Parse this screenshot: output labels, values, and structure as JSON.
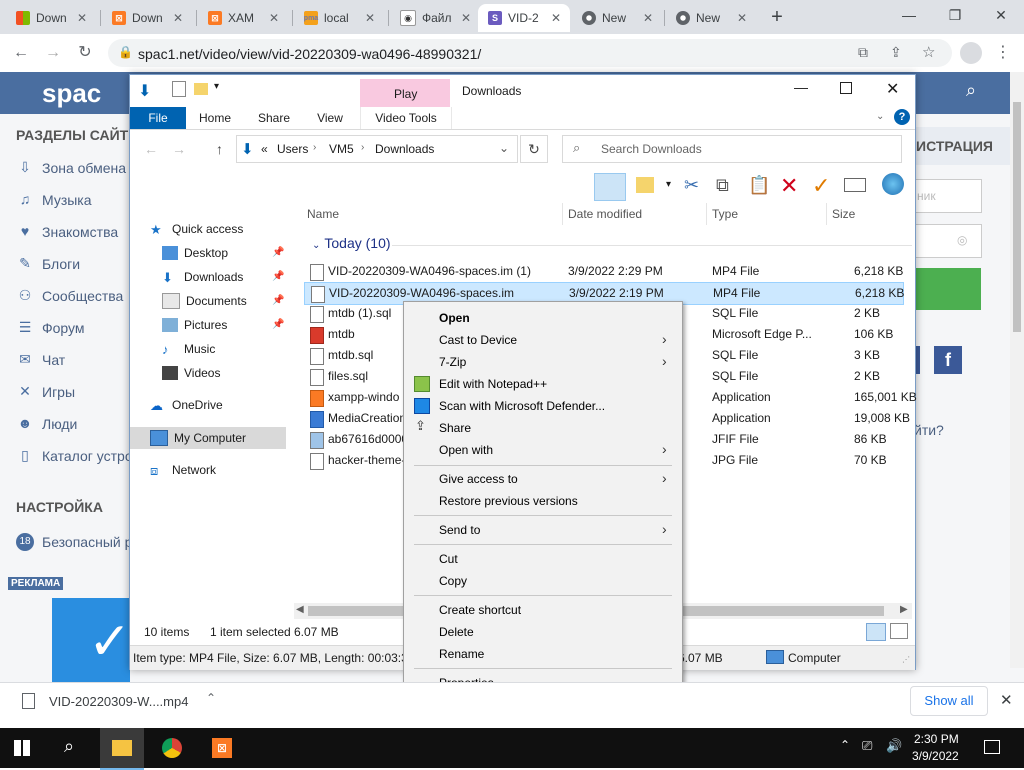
{
  "browser": {
    "tabs": [
      {
        "title": "Down",
        "favicon": "windows-icon",
        "active": false
      },
      {
        "title": "Down",
        "favicon": "xampp-icon",
        "active": false
      },
      {
        "title": "XAM",
        "favicon": "xampp-icon",
        "active": false
      },
      {
        "title": "local",
        "favicon": "phpmyadmin-icon",
        "active": false
      },
      {
        "title": "Файл",
        "favicon": "eye-icon",
        "active": false
      },
      {
        "title": "VID-2",
        "favicon": "spaces-s-icon",
        "active": true
      },
      {
        "title": "New",
        "favicon": "chrome-icon",
        "active": false
      },
      {
        "title": "New",
        "favicon": "chrome-icon",
        "active": false
      }
    ],
    "new_tab": "+",
    "url": "spac1.net/video/view/vid-20220309-wa0496-48990321/",
    "controls": {
      "minimize": "—",
      "maximize": "❐",
      "close": "✕"
    }
  },
  "website": {
    "logo": "spac",
    "sections_heading": "РАЗДЕЛЫ САЙТ",
    "menu": [
      {
        "label": "Зона обмена",
        "icon": "download-icon"
      },
      {
        "label": "Музыка",
        "icon": "music-icon"
      },
      {
        "label": "Знакомства",
        "icon": "heart-icon"
      },
      {
        "label": "Блоги",
        "icon": "pen-icon"
      },
      {
        "label": "Сообщества",
        "icon": "people-icon"
      },
      {
        "label": "Форум",
        "icon": "forum-icon"
      },
      {
        "label": "Чат",
        "icon": "chat-icon"
      },
      {
        "label": "Игры",
        "icon": "games-icon"
      },
      {
        "label": "Люди",
        "icon": "user-icon"
      },
      {
        "label": "Каталог устро",
        "icon": "phone-icon"
      }
    ],
    "settings_heading": "НАСТРОЙКА",
    "safe_mode": "Безопасный р",
    "safe_badge": "18",
    "ad_label": "РЕКЛАМА",
    "register_label": "ИСТРАЦИЯ",
    "login_placeholder": "ник",
    "forgot": "йти?",
    "facebook": "f"
  },
  "explorer": {
    "title": "Downloads",
    "ribbon_tabs": [
      "File",
      "Home",
      "Share",
      "View"
    ],
    "contextual_tab_group": "Play",
    "contextual_tab": "Video Tools",
    "breadcrumb": [
      "Users",
      "VM5",
      "Downloads"
    ],
    "breadcrumb_prefix": "«",
    "search_placeholder": "Search Downloads",
    "columns": [
      "Name",
      "Date modified",
      "Type",
      "Size"
    ],
    "group": "Today (10)",
    "nav": [
      {
        "label": "Quick access",
        "icon": "star-icon",
        "pinned": false
      },
      {
        "label": "Desktop",
        "icon": "desktop-folder-icon",
        "pinned": true
      },
      {
        "label": "Downloads",
        "icon": "downloads-folder-icon",
        "pinned": true
      },
      {
        "label": "Documents",
        "icon": "documents-folder-icon",
        "pinned": true
      },
      {
        "label": "Pictures",
        "icon": "pictures-folder-icon",
        "pinned": true
      },
      {
        "label": "Music",
        "icon": "music-folder-icon",
        "pinned": false
      },
      {
        "label": "Videos",
        "icon": "videos-folder-icon",
        "pinned": false
      },
      {
        "label": "OneDrive",
        "icon": "cloud-icon",
        "pinned": false
      },
      {
        "label": "My Computer",
        "icon": "computer-icon",
        "pinned": false
      },
      {
        "label": "Network",
        "icon": "network-icon",
        "pinned": false
      }
    ],
    "files": [
      {
        "name": "VID-20220309-WA0496-spaces.im (1)",
        "date": "3/9/2022 2:29 PM",
        "type": "MP4 File",
        "size": "6,218 KB",
        "selected": false
      },
      {
        "name": "VID-20220309-WA0496-spaces.im",
        "date": "3/9/2022 2:19 PM",
        "type": "MP4 File",
        "size": "6,218 KB",
        "selected": true
      },
      {
        "name": "mtdb (1).sql",
        "date": "",
        "type": "SQL File",
        "size": "2 KB",
        "selected": false
      },
      {
        "name": "mtdb",
        "date": "",
        "type": "Microsoft Edge P...",
        "size": "106 KB",
        "selected": false
      },
      {
        "name": "mtdb.sql",
        "date": "",
        "type": "SQL File",
        "size": "3 KB",
        "selected": false
      },
      {
        "name": "files.sql",
        "date": "",
        "type": "SQL File",
        "size": "2 KB",
        "selected": false
      },
      {
        "name": "xampp-windo",
        "date": "",
        "type": "Application",
        "size": "165,001 KB",
        "selected": false
      },
      {
        "name": "MediaCreation",
        "date": "",
        "type": "Application",
        "size": "19,008 KB",
        "selected": false
      },
      {
        "name": "ab67616d0000",
        "date": "",
        "type": "JFIF File",
        "size": "86 KB",
        "selected": false
      },
      {
        "name": "hacker-theme-",
        "date": "",
        "type": "JPG File",
        "size": "70 KB",
        "selected": false
      }
    ],
    "status": {
      "items": "10 items",
      "selected": "1 item selected",
      "size": "6.07 MB"
    },
    "details_bar": {
      "info": "Item type: MP4 File, Size: 6.07 MB, Length: 00:03:38",
      "size": "6.07 MB",
      "location": "Computer"
    }
  },
  "context_menu": {
    "groups": [
      [
        {
          "label": "Open",
          "bold": true,
          "submenu": false,
          "icon": ""
        },
        {
          "label": "Cast to Device",
          "bold": false,
          "submenu": true,
          "icon": ""
        },
        {
          "label": "7-Zip",
          "bold": false,
          "submenu": true,
          "icon": ""
        },
        {
          "label": "Edit with Notepad++",
          "bold": false,
          "submenu": false,
          "icon": "notepadpp-icon"
        },
        {
          "label": "Scan with Microsoft Defender...",
          "bold": false,
          "submenu": false,
          "icon": "defender-icon"
        },
        {
          "label": "Share",
          "bold": false,
          "submenu": false,
          "icon": "share-icon"
        },
        {
          "label": "Open with",
          "bold": false,
          "submenu": true,
          "icon": ""
        }
      ],
      [
        {
          "label": "Give access to",
          "bold": false,
          "submenu": true,
          "icon": ""
        },
        {
          "label": "Restore previous versions",
          "bold": false,
          "submenu": false,
          "icon": ""
        }
      ],
      [
        {
          "label": "Send to",
          "bold": false,
          "submenu": true,
          "icon": ""
        }
      ],
      [
        {
          "label": "Cut",
          "bold": false,
          "submenu": false,
          "icon": ""
        },
        {
          "label": "Copy",
          "bold": false,
          "submenu": false,
          "icon": ""
        }
      ],
      [
        {
          "label": "Create shortcut",
          "bold": false,
          "submenu": false,
          "icon": ""
        },
        {
          "label": "Delete",
          "bold": false,
          "submenu": false,
          "icon": ""
        },
        {
          "label": "Rename",
          "bold": false,
          "submenu": false,
          "icon": ""
        }
      ],
      [
        {
          "label": "Properties",
          "bold": false,
          "submenu": false,
          "icon": ""
        }
      ]
    ]
  },
  "download_bar": {
    "file": "VID-20220309-W....mp4",
    "show_all": "Show all"
  },
  "taskbar": {
    "time": "2:30 PM",
    "date": "3/9/2022",
    "pinned": [
      "file-explorer-icon",
      "chrome-icon",
      "xampp-icon"
    ]
  },
  "colors": {
    "chrome_tabstrip": "#dee1e6",
    "site_header": "#4a6ea0",
    "explorer_accent": "#0063b1",
    "selection": "#cce8ff",
    "play_tab": "#f9c9e0",
    "taskbar": "#101010"
  }
}
